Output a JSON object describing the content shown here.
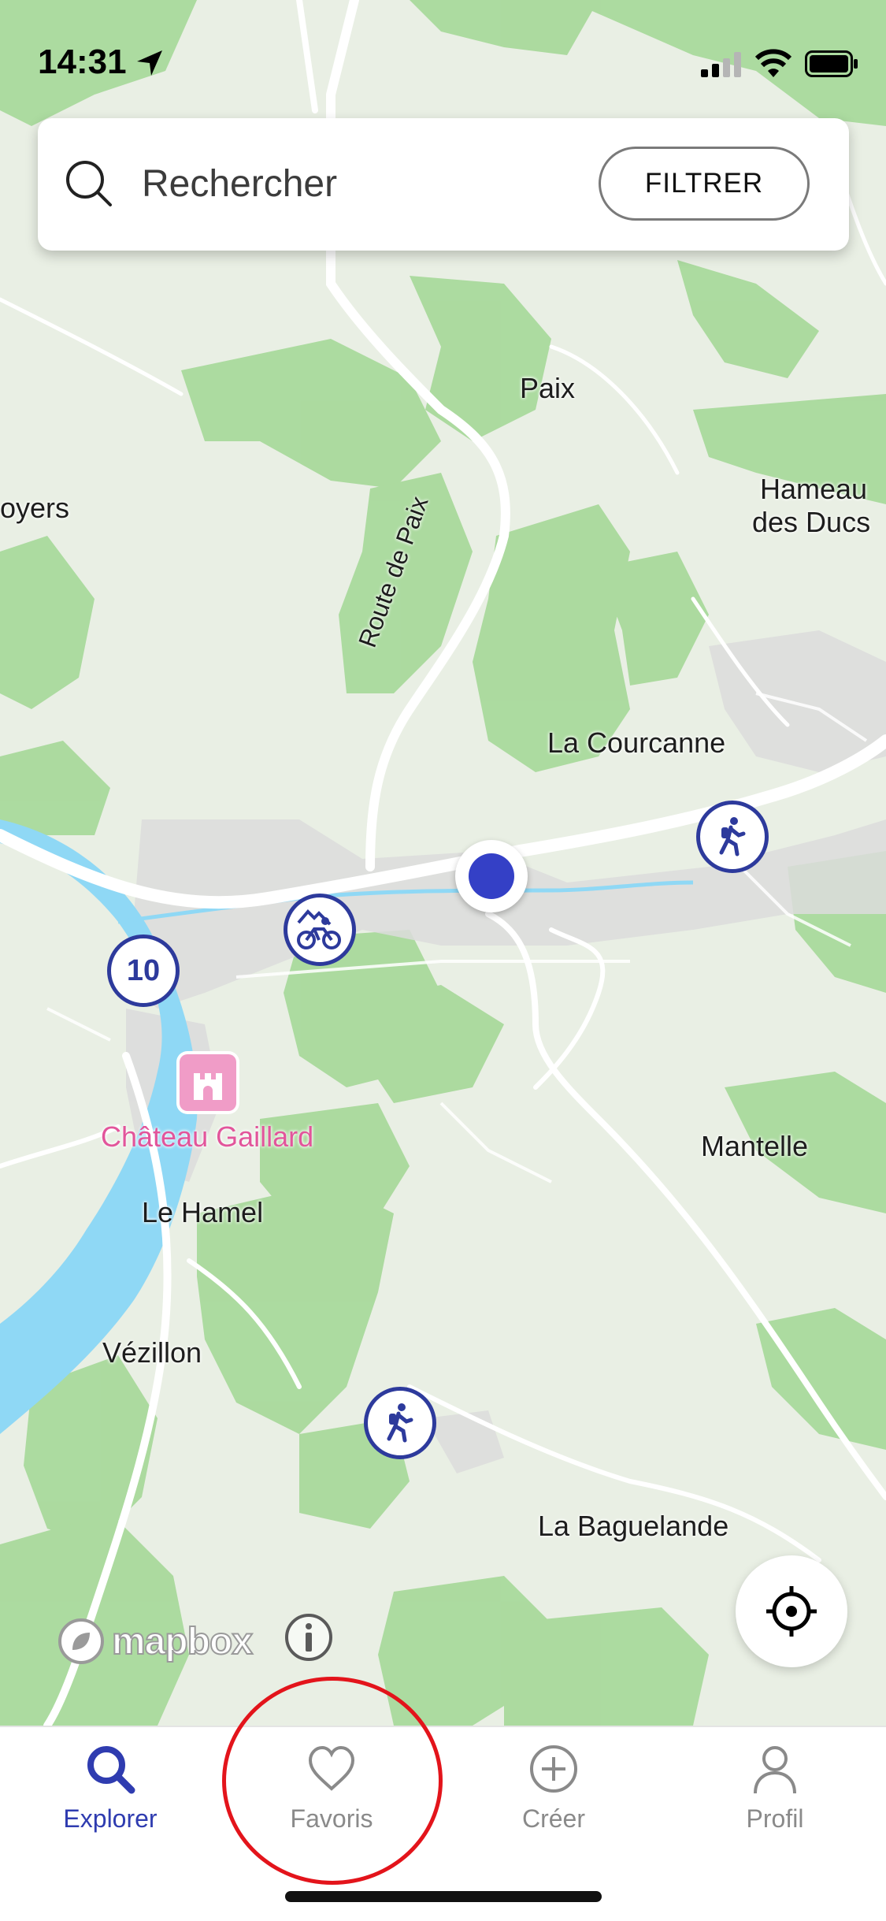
{
  "status_bar": {
    "time": "14:31"
  },
  "search": {
    "placeholder": "Rechercher",
    "filter_label": "FILTRER"
  },
  "map": {
    "places": [
      {
        "name": "Paix",
        "style": "normal"
      },
      {
        "name": "oyers",
        "style": "normal"
      },
      {
        "name": "Hameau",
        "style": "normal"
      },
      {
        "name": "des Ducs",
        "style": "normal"
      },
      {
        "name": "Route de Paix",
        "style": "road"
      },
      {
        "name": "La Courcanne",
        "style": "normal"
      },
      {
        "name": "Château Gaillard",
        "style": "pink"
      },
      {
        "name": "Mantelle",
        "style": "normal"
      },
      {
        "name": "Le Hamel",
        "style": "normal"
      },
      {
        "name": "Vézillon",
        "style": "normal"
      },
      {
        "name": "La Baguelande",
        "style": "normal"
      }
    ],
    "markers": [
      {
        "type": "cluster",
        "label": "10"
      },
      {
        "type": "bike",
        "icon": "mountain-bike-icon"
      },
      {
        "type": "hike",
        "icon": "hiker-icon"
      },
      {
        "type": "hike",
        "icon": "hiker-icon"
      }
    ],
    "attribution": {
      "logo_text": "mapbox"
    }
  },
  "tabs": [
    {
      "label": "Explorer",
      "icon": "search-icon",
      "active": true
    },
    {
      "label": "Favoris",
      "icon": "heart-icon",
      "active": false
    },
    {
      "label": "Créer",
      "icon": "plus-circle-icon",
      "active": false
    },
    {
      "label": "Profil",
      "icon": "person-icon",
      "active": false
    }
  ],
  "colors": {
    "accent": "#2F3CB0",
    "marker": "#2D3A9C",
    "forest": "#A9D99C",
    "water": "#8FD8F5",
    "annotation": "#E3141B",
    "pink": "#E2559B"
  }
}
